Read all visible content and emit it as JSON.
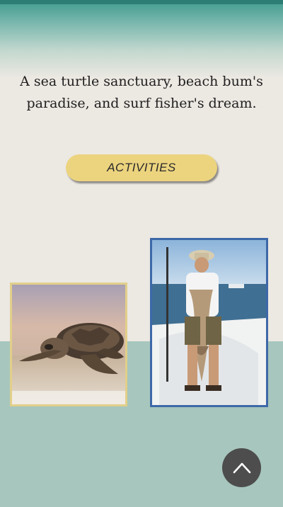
{
  "hero": {
    "tagline": "A sea turtle sanctuary, beach bum's paradise, and surf fisher's dream."
  },
  "cta": {
    "activities_label": "ACTIVITIES"
  },
  "photos": [
    {
      "name": "sea-turtle-photo",
      "icon": "sea-turtle-image"
    },
    {
      "name": "surf-fisher-photo",
      "icon": "fisherman-with-fish-image"
    }
  ],
  "scroll_top": {
    "icon": "chevron-up-icon"
  },
  "colors": {
    "accent_button": "#ecd47f",
    "teal_top": "#2c7d74",
    "bottom_band": "#a7c6bd",
    "background": "#ece8e2",
    "turtle_frame": "#e2cf8a",
    "fisher_frame": "#3d68a8",
    "scroll_button": "#4d4d4d"
  }
}
